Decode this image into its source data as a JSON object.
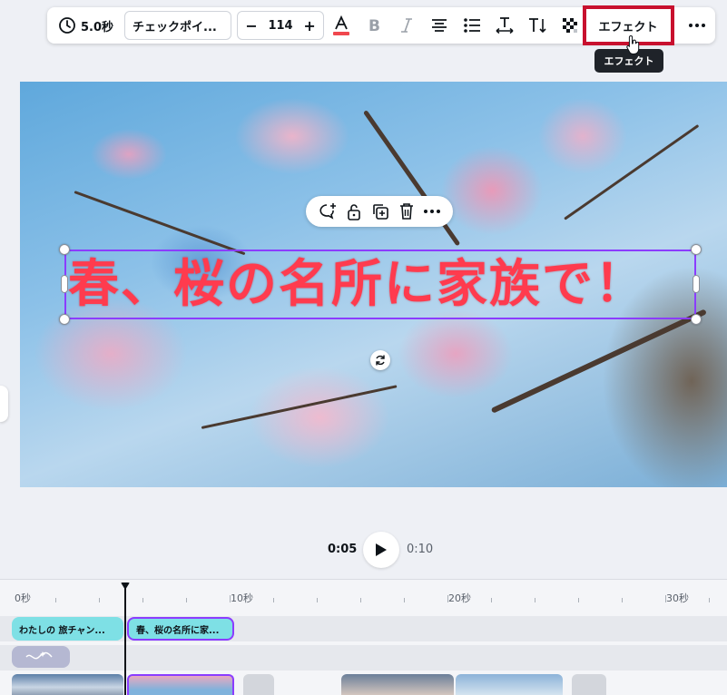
{
  "toolbar": {
    "duration": "5.0秒",
    "font_name": "チェックポイ...",
    "font_size": "114",
    "decrease": "−",
    "increase": "+",
    "effect_label": "エフェクト"
  },
  "tooltip": {
    "text": "エフェクト"
  },
  "canvas": {
    "headline": "春、桜の名所に家族で！",
    "headline_color": "#ff3b4e",
    "selection_color": "#8b3dff"
  },
  "playback": {
    "current_time": "0:05",
    "total_time": "0:10"
  },
  "timeline": {
    "ruler": [
      "0秒",
      "10秒",
      "20秒",
      "30秒"
    ],
    "clips": [
      {
        "label": "わたしの 旅チャン..."
      },
      {
        "label": "春、桜の名所に家..."
      }
    ]
  },
  "colors": {
    "highlight": "#c8102e",
    "clip": "#7ee0e5",
    "accent": "#8b3dff"
  }
}
